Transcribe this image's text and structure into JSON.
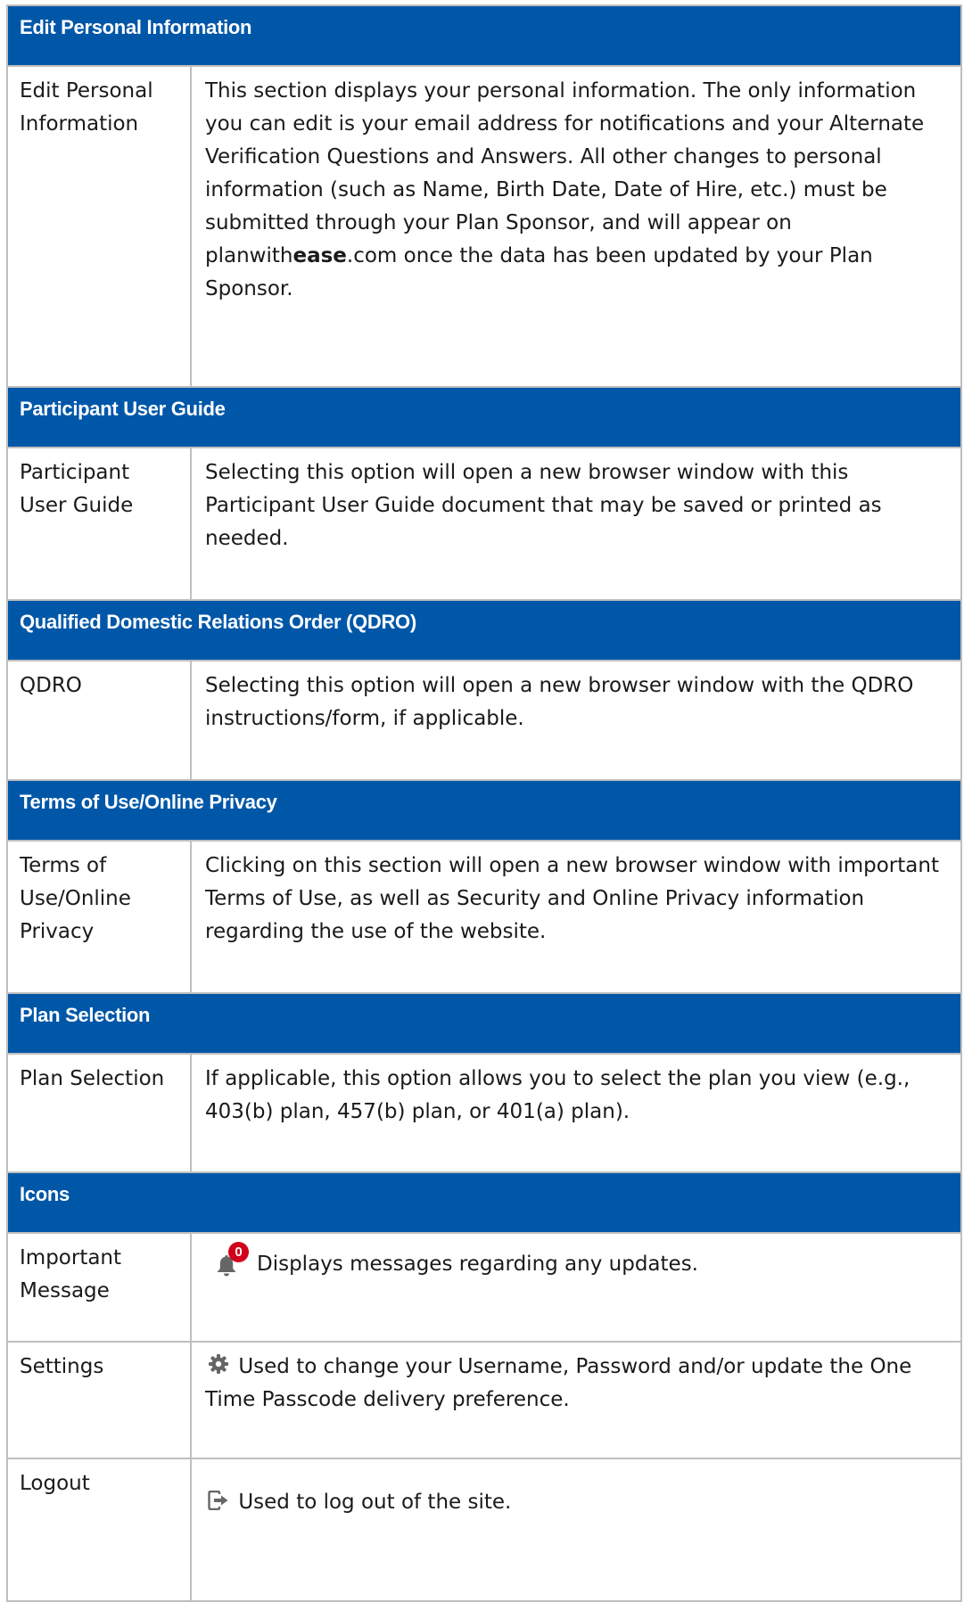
{
  "sections": {
    "personal": {
      "header": "Edit Personal Information",
      "label": "Edit Personal Information",
      "desc_before": "This section displays your personal information. The only information you can edit is your email address for notifications and your Alternate Verification Questions and Answers. All other changes to personal information (such as Name, Birth Date, Date of Hire, etc.) must be submitted through your Plan Sponsor, and will appear on planwith",
      "desc_bold": "ease",
      "desc_after": ".com once the data has been updated by your Plan Sponsor."
    },
    "guide": {
      "header": "Participant User Guide",
      "label": "Participant User Guide",
      "desc": "Selecting this option will open a new browser window with this Participant User Guide document that may be saved or printed as needed."
    },
    "qdro": {
      "header": "Qualified Domestic Relations Order (QDRO)",
      "label": "QDRO",
      "desc": "Selecting this option will open a new browser window with the QDRO instructions/form, if applicable."
    },
    "terms": {
      "header": "Terms of Use/Online Privacy",
      "label": "Terms of Use/Online Privacy",
      "desc": "Clicking on this section will open a new browser window with important Terms of Use, as well as Security and Online Privacy information regarding the use of the website."
    },
    "plan": {
      "header": "Plan Selection",
      "label": "Plan Selection",
      "desc": "If applicable, this option allows you to select the plan you view (e.g., 403(b) plan, 457(b) plan, or 401(a) plan)."
    },
    "icons": {
      "header": "Icons",
      "message": {
        "label": "Important Message",
        "icon": "bell-icon",
        "badge": "0",
        "desc": "Displays messages regarding any updates."
      },
      "settings": {
        "label": "Settings",
        "icon": "gear-icon",
        "desc": "Used to change your Username, Password and/or update the One Time Passcode delivery preference."
      },
      "logout": {
        "label": "Logout",
        "icon": "logout-icon",
        "desc": "Used to log out of the site."
      }
    }
  },
  "colors": {
    "header_bg": "#0057a8",
    "header_text": "#ffffff",
    "badge": "#d0021b",
    "icon": "#666666"
  }
}
